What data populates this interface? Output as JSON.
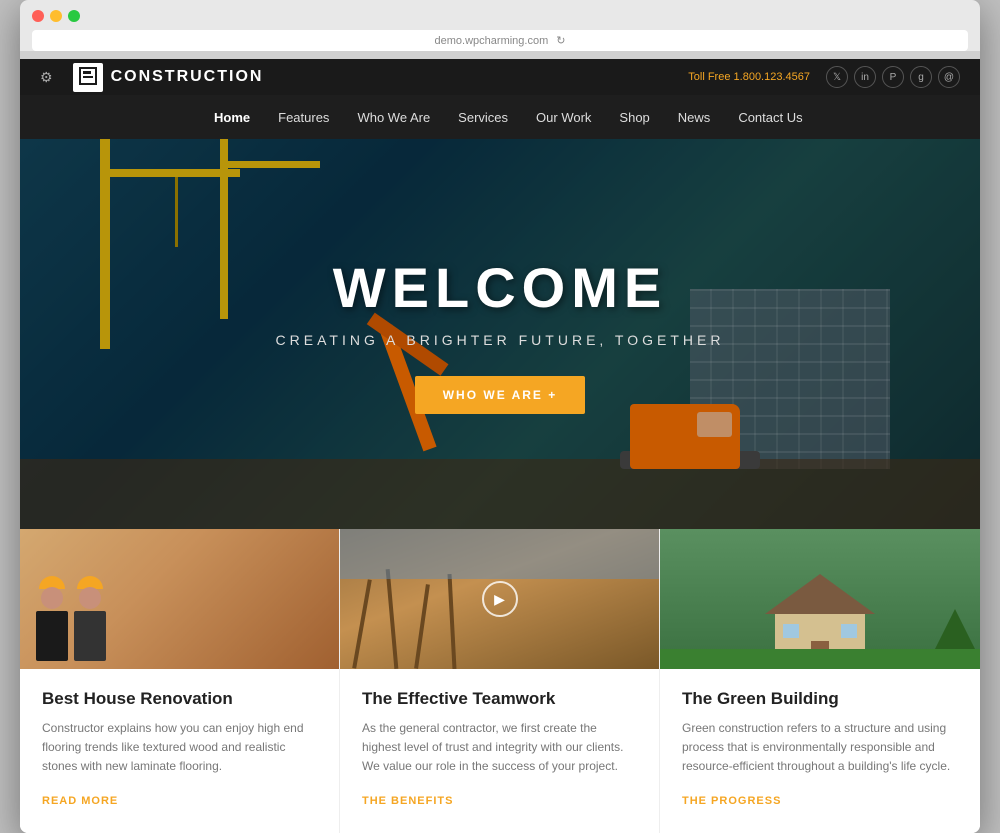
{
  "browser": {
    "url": "demo.wpcharming.com",
    "dots": [
      "red",
      "yellow",
      "green"
    ]
  },
  "header": {
    "logo_icon": "C",
    "logo_text": "CONSTRUCTION",
    "toll_free_label": "Toll Free",
    "phone": "1.800.123.4567",
    "social_icons": [
      "t",
      "in",
      "p",
      "g+",
      "@"
    ]
  },
  "nav": {
    "items": [
      {
        "label": "Home",
        "active": true
      },
      {
        "label": "Features",
        "active": false
      },
      {
        "label": "Who We Are",
        "active": false
      },
      {
        "label": "Services",
        "active": false
      },
      {
        "label": "Our Work",
        "active": false
      },
      {
        "label": "Shop",
        "active": false
      },
      {
        "label": "News",
        "active": false
      },
      {
        "label": "Contact Us",
        "active": false
      }
    ]
  },
  "hero": {
    "title": "WELCOME",
    "subtitle": "CREATING A BRIGHTER FUTURE, TOGETHER",
    "button_label": "WHO WE ARE +"
  },
  "cards": [
    {
      "title": "Best House Renovation",
      "text": "Constructor explains how you can enjoy high end flooring trends like textured wood and realistic stones with new laminate flooring.",
      "link_label": "READ MORE",
      "has_play": false
    },
    {
      "title": "The Effective Teamwork",
      "text": "As the general contractor, we first create the highest level of trust and integrity with our clients. We value our role in the success of your project.",
      "link_label": "THE BENEFITS",
      "has_play": true
    },
    {
      "title": "The Green Building",
      "text": "Green construction refers to a structure and using process that is environmentally responsible and resource-efficient throughout a building's life cycle.",
      "link_label": "THE PROGRESS",
      "has_play": false
    }
  ]
}
